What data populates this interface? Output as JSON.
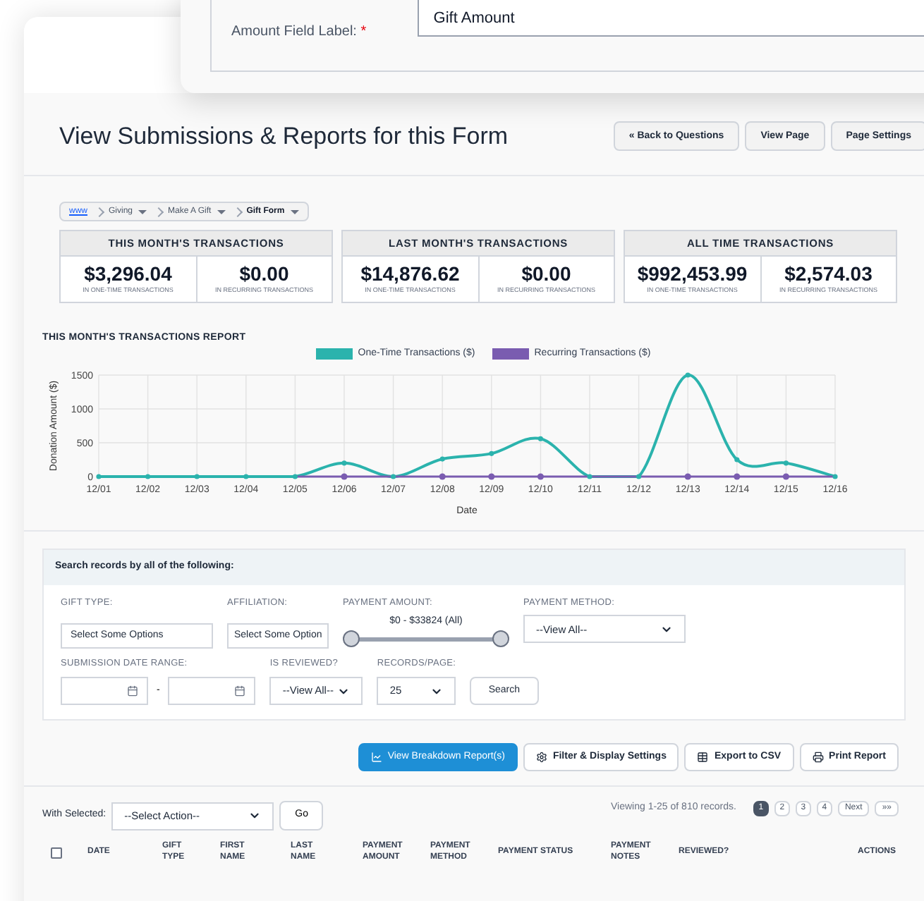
{
  "top_card": {
    "label": "Amount Field Label:",
    "required_mark": "*",
    "value": "Gift Amount"
  },
  "header": {
    "title": "View Submissions & Reports for this Form",
    "buttons": [
      "« Back to Questions",
      "View Page",
      "Page Settings"
    ]
  },
  "breadcrumb": [
    {
      "label": "www",
      "link": true,
      "dropdown": false,
      "current": false
    },
    {
      "label": "Giving",
      "link": false,
      "dropdown": true,
      "current": false
    },
    {
      "label": "Make A Gift",
      "link": false,
      "dropdown": true,
      "current": false
    },
    {
      "label": "Gift Form",
      "link": false,
      "dropdown": true,
      "current": true
    }
  ],
  "stats": [
    {
      "title": "THIS MONTH'S TRANSACTIONS",
      "items": [
        {
          "amount": "$3,296.04",
          "caption": "IN ONE-TIME TRANSACTIONS"
        },
        {
          "amount": "$0.00",
          "caption": "IN RECURRING TRANSACTIONS"
        }
      ]
    },
    {
      "title": "LAST MONTH'S TRANSACTIONS",
      "items": [
        {
          "amount": "$14,876.62",
          "caption": "IN ONE-TIME TRANSACTIONS"
        },
        {
          "amount": "$0.00",
          "caption": "IN RECURRING TRANSACTIONS"
        }
      ]
    },
    {
      "title": "ALL TIME TRANSACTIONS",
      "items": [
        {
          "amount": "$992,453.99",
          "caption": "IN ONE-TIME TRANSACTIONS"
        },
        {
          "amount": "$2,574.03",
          "caption": "IN RECURRING TRANSACTIONS"
        }
      ]
    }
  ],
  "report": {
    "title": "THIS MONTH'S TRANSACTIONS REPORT",
    "chart_data": {
      "type": "line",
      "xlabel": "Date",
      "ylabel": "Donation Amount ($)",
      "categories": [
        "12/01",
        "12/02",
        "12/03",
        "12/04",
        "12/05",
        "12/06",
        "12/07",
        "12/08",
        "12/09",
        "12/10",
        "12/11",
        "12/12",
        "12/13",
        "12/14",
        "12/15",
        "12/16"
      ],
      "series": [
        {
          "name": "One-Time Transactions ($)",
          "color": "#2bb3ad",
          "marker": "circle",
          "values": [
            0,
            0,
            0,
            0,
            0,
            200,
            0,
            260,
            340,
            560,
            0,
            0,
            1500,
            250,
            200,
            0
          ]
        },
        {
          "name": "Recurring Transactions ($)",
          "color": "#7a5cb0",
          "marker": "circle",
          "values": [
            null,
            null,
            null,
            null,
            0,
            0,
            0,
            0,
            0,
            0,
            0,
            0,
            0,
            0,
            0,
            0
          ]
        }
      ],
      "ylim": [
        0,
        1500
      ],
      "yticks": [
        0,
        500,
        1000,
        1500
      ],
      "grid": true,
      "legend": true
    }
  },
  "search": {
    "title": "Search records by all of the following:",
    "gift_type": {
      "label": "GIFT TYPE:",
      "placeholder": "Select Some Options"
    },
    "affiliation": {
      "label": "AFFILIATION:",
      "placeholder": "Select Some Option"
    },
    "payment_amount": {
      "label": "PAYMENT AMOUNT:",
      "reading": "$0 - $33824 (All)",
      "handles": [
        {
          "level": 0
        },
        {
          "level": 1
        }
      ]
    },
    "payment_method": {
      "label": "PAYMENT METHOD:",
      "value": "--View All--"
    },
    "date_range": {
      "label": "SUBMISSION DATE RANGE:",
      "separator": "-"
    },
    "reviewed": {
      "label": "IS REVIEWED?",
      "value": "--View All--"
    },
    "records_per_page": {
      "label": "RECORDS/PAGE:",
      "value": "25"
    },
    "button": "Search"
  },
  "actions": [
    {
      "label": "View Breakdown Report(s)",
      "kind": "chart",
      "primary": true
    },
    {
      "label": "Filter & Display Settings",
      "kind": "gear",
      "primary": false
    },
    {
      "label": "Export to CSV",
      "kind": "table",
      "primary": false
    },
    {
      "label": "Print Report",
      "kind": "print",
      "primary": false
    }
  ],
  "bulk": {
    "label": "With Selected:",
    "value": "--Select Action--",
    "button": "Go"
  },
  "pagination": {
    "summary": "Viewing 1-25 of 810 records.",
    "pages": [
      {
        "label": "1",
        "selected": true
      },
      {
        "label": "2",
        "selected": false
      },
      {
        "label": "3",
        "selected": false
      },
      {
        "label": "4",
        "selected": false
      }
    ],
    "next": "Next",
    "last": "»»"
  },
  "table": {
    "select_all_checked": false,
    "columns": [
      [
        "DATE"
      ],
      [
        "GIFT",
        "TYPE"
      ],
      [
        "FIRST",
        "NAME"
      ],
      [
        "LAST",
        "NAME"
      ],
      [
        "PAYMENT",
        "AMOUNT"
      ],
      [
        "PAYMENT",
        "METHOD"
      ],
      [
        "PAYMENT STATUS"
      ],
      [
        "PAYMENT",
        "NOTES"
      ],
      [
        "REVIEWED?"
      ],
      [
        "ACTIONS"
      ]
    ]
  }
}
